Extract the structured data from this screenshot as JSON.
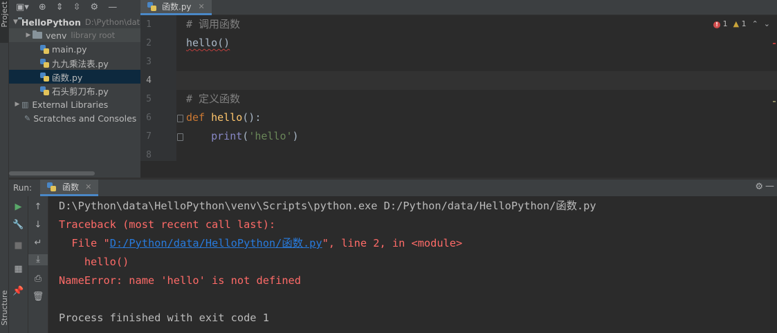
{
  "strip": {
    "project_tab": "Project",
    "structure_tab": "Structure"
  },
  "project": {
    "root_name": "HelloPython",
    "root_path": "D:\\Python\\data\\HelloPython",
    "items": [
      {
        "name": "venv",
        "suffix": "library root"
      },
      {
        "name": "main.py"
      },
      {
        "name": "九九乘法表.py"
      },
      {
        "name": "函数.py"
      },
      {
        "name": "石头剪刀布.py"
      },
      {
        "name": "External Libraries"
      },
      {
        "name": "Scratches and Consoles"
      }
    ]
  },
  "editor": {
    "tab_label": "函数.py",
    "inspections": {
      "errors": "1",
      "warnings": "1"
    },
    "line_numbers": [
      "1",
      "2",
      "3",
      "4",
      "5",
      "6",
      "7",
      "8"
    ],
    "lines": {
      "l1_comment": "# 调用函数",
      "l2_call": "hello()",
      "l5_comment": "# 定义函数",
      "l6_def": "def",
      "l6_name": "hello",
      "l6_rest": "():",
      "l7_indent": "    ",
      "l7_print": "print",
      "l7_open": "(",
      "l7_string": "'hello'",
      "l7_close": ")"
    }
  },
  "run": {
    "label": "Run:",
    "tab_label": "函数",
    "console": {
      "command": "D:\\Python\\data\\HelloPython\\venv\\Scripts\\python.exe D:/Python/data/HelloPython/函数.py",
      "traceback": "Traceback (most recent call last):",
      "file_prefix": "  File \"",
      "file_link": "D:/Python/data/HelloPython/函数.py",
      "file_suffix": "\", line 2, in <module>",
      "code_line": "    hello()",
      "error": "NameError: name 'hello' is not defined",
      "exit": "Process finished with exit code 1"
    }
  },
  "colors": {
    "background": "#2b2b2b",
    "panel": "#3c3f41",
    "selection": "#0d293e",
    "error_text": "#ff6b68",
    "link": "#287bde",
    "keyword": "#cc7832",
    "function": "#ffc66d",
    "string": "#6a8759"
  }
}
